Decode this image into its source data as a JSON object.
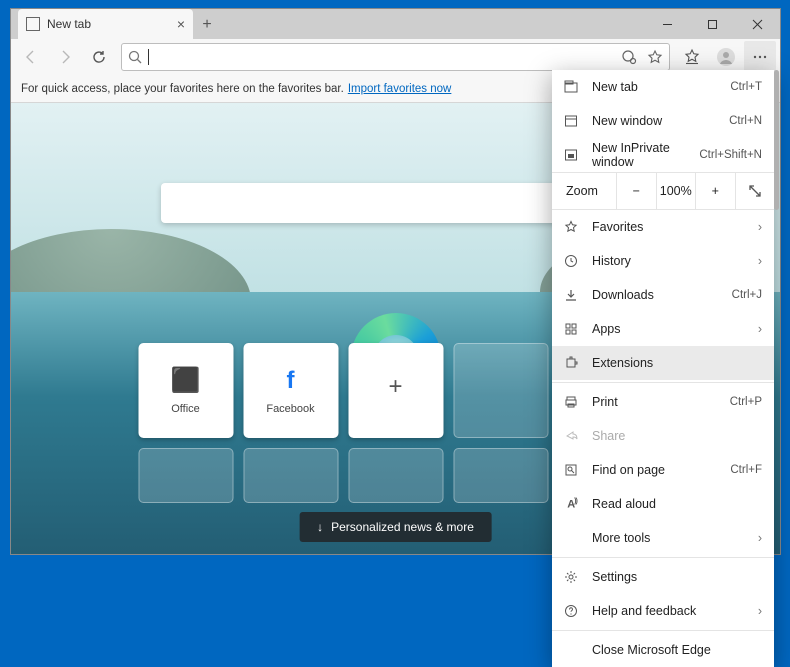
{
  "tab": {
    "title": "New tab"
  },
  "favbar": {
    "text": "For quick access, place your favorites here on the favorites bar.",
    "link": "Import favorites now"
  },
  "tiles": {
    "items": [
      {
        "label": "Office"
      },
      {
        "label": "Facebook"
      }
    ]
  },
  "newsbar": {
    "label": "Personalized news & more"
  },
  "menu": {
    "newtab": {
      "label": "New tab",
      "shortcut": "Ctrl+T"
    },
    "newwindow": {
      "label": "New window",
      "shortcut": "Ctrl+N"
    },
    "inprivate": {
      "label": "New InPrivate window",
      "shortcut": "Ctrl+Shift+N"
    },
    "zoom": {
      "label": "Zoom",
      "value": "100%"
    },
    "favorites": {
      "label": "Favorites"
    },
    "history": {
      "label": "History"
    },
    "downloads": {
      "label": "Downloads",
      "shortcut": "Ctrl+J"
    },
    "apps": {
      "label": "Apps"
    },
    "extensions": {
      "label": "Extensions"
    },
    "print": {
      "label": "Print",
      "shortcut": "Ctrl+P"
    },
    "share": {
      "label": "Share"
    },
    "find": {
      "label": "Find on page",
      "shortcut": "Ctrl+F"
    },
    "readaloud": {
      "label": "Read aloud"
    },
    "moretools": {
      "label": "More tools"
    },
    "settings": {
      "label": "Settings"
    },
    "help": {
      "label": "Help and feedback"
    },
    "close": {
      "label": "Close Microsoft Edge"
    }
  }
}
